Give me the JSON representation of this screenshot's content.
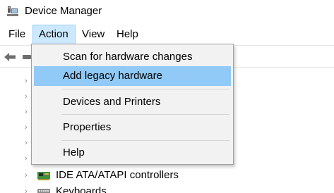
{
  "window": {
    "title": "Device Manager",
    "icon": "device-manager-icon"
  },
  "menubar": {
    "items": [
      {
        "label": "File"
      },
      {
        "label": "Action",
        "active": true
      },
      {
        "label": "View"
      },
      {
        "label": "Help"
      }
    ]
  },
  "toolbar": {
    "icons": [
      "back-arrow-icon",
      "forward-arrow-icon"
    ]
  },
  "action_menu": {
    "items": [
      {
        "label": "Scan for hardware changes"
      },
      {
        "label": "Add legacy hardware",
        "highlighted": true
      },
      {
        "label": "Devices and Printers"
      },
      {
        "label": "Properties"
      },
      {
        "label": "Help"
      }
    ]
  },
  "tree": {
    "visible_items": [
      {
        "label": "IDE ATA/ATAPI controllers",
        "icon": "ide-controller-icon"
      },
      {
        "label": "Keyboards",
        "icon": "keyboard-icon"
      }
    ]
  },
  "colors": {
    "menu_active_bg": "#cce8ff",
    "menu_highlight_bg": "#91c9f7",
    "dropdown_bg": "#f2f2f2"
  }
}
